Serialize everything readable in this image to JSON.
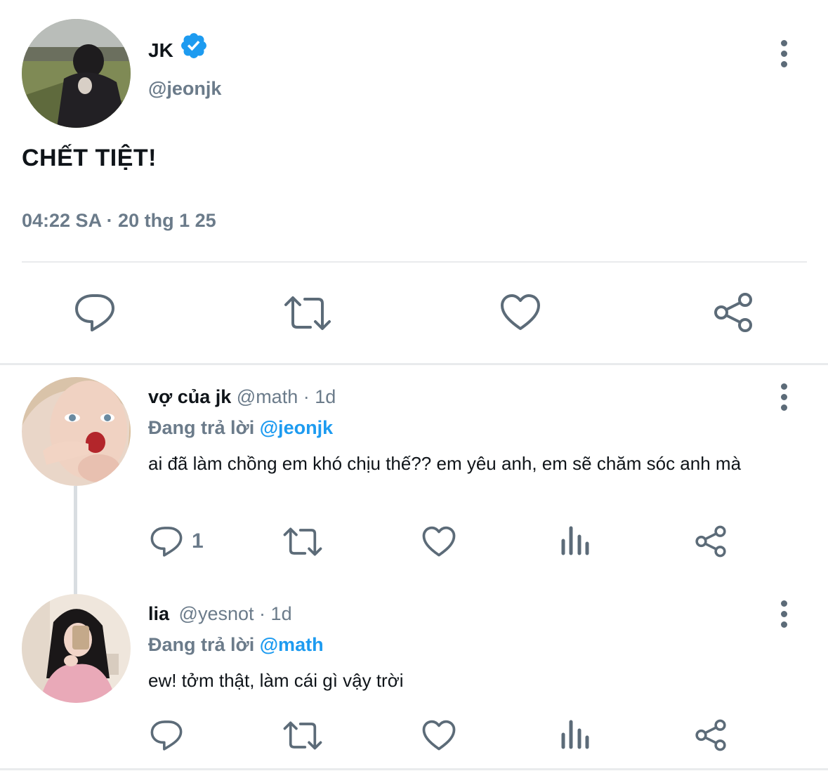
{
  "main_tweet": {
    "name": "JK",
    "handle": "@jeonjk",
    "text": "CHẾT TIỆT!",
    "time": "04:22 SA · 20 thg 1 25",
    "icons": [
      "reply-icon",
      "retweet-icon",
      "like-icon",
      "share-icon"
    ]
  },
  "replies": [
    {
      "name": "vợ của jk",
      "handle": "@math",
      "time_sep": "·",
      "age": "1d",
      "replying_prefix": "Đang trả lời",
      "replying_to": "@jeonjk",
      "text": "ai đã làm chồng em khó chịu thế?? em yêu anh, em sẽ chăm sóc anh mà",
      "reply_count": "1"
    },
    {
      "name": "lia",
      "handle": "@yesnot",
      "time_sep": "·",
      "age": "1d",
      "replying_prefix": "Đang trả lời",
      "replying_to": "@math",
      "text": "ew! tởm thật, làm cái gì vậy trời",
      "reply_count": ""
    }
  ],
  "colors": {
    "accent": "#1d9bf0",
    "muted": "#6b7b8a",
    "icon": "#5c6b78",
    "divider": "#e9ebed"
  }
}
